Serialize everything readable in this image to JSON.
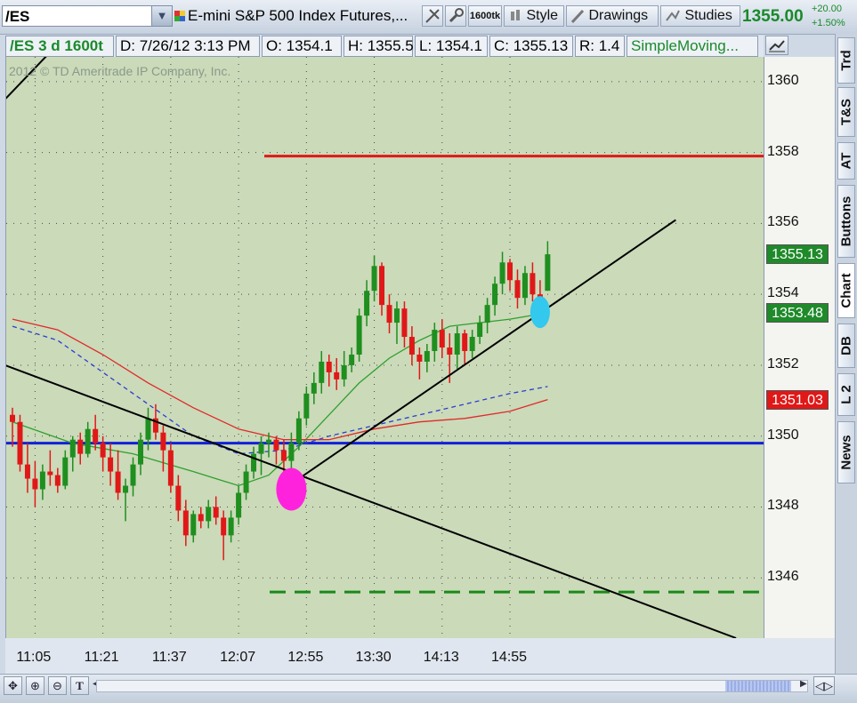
{
  "toolbar": {
    "symbol": "/ES",
    "description": "E-mini S&P 500 Index Futures,...",
    "aggregation_badge": "1600tk",
    "style_label": "Style",
    "drawings_label": "Drawings",
    "studies_label": "Studies",
    "last_price": "1355.00",
    "net_change": "+20.00",
    "pct_change": "+1.50%"
  },
  "infobar": {
    "symbol_period": "/ES 3 d 1600t",
    "date": "D: 7/26/12 3:13 PM",
    "open": "O: 1354.1",
    "high": "H: 1355.5",
    "low": "L: 1354.1",
    "close": "C: 1355.13",
    "range": "R: 1.4",
    "study": "SimpleMoving..."
  },
  "copyright": "2012 © TD Ameritrade IP Company, Inc.",
  "side_tabs": [
    "Trd",
    "T&S",
    "AT",
    "Buttons",
    "Chart",
    "DB",
    "L 2",
    "News"
  ],
  "price_badges": [
    {
      "label": "1355.13",
      "value": 1355.13,
      "color": "#1f8a2a"
    },
    {
      "label": "1353.48",
      "value": 1353.48,
      "color": "#1f8a2a"
    },
    {
      "label": "1351.03",
      "value": 1351.03,
      "color": "#e01818"
    }
  ],
  "chart_data": {
    "type": "candlestick",
    "title": "",
    "xlabel": "",
    "ylabel": "",
    "ylim": [
      1344.3,
      1360.7
    ],
    "y_ticks": [
      1346,
      1348,
      1350,
      1352,
      1354,
      1356,
      1358,
      1360
    ],
    "x_ticks": [
      {
        "label": "11:05",
        "index": 3
      },
      {
        "label": "11:21",
        "index": 12
      },
      {
        "label": "11:37",
        "index": 21
      },
      {
        "label": "12:07",
        "index": 30
      },
      {
        "label": "12:55",
        "index": 39
      },
      {
        "label": "13:30",
        "index": 48
      },
      {
        "label": "14:13",
        "index": 57
      },
      {
        "label": "14:55",
        "index": 66
      }
    ],
    "grid": true,
    "candles": [
      {
        "o": 1350.6,
        "h": 1350.8,
        "l": 1349.7,
        "c": 1350.4
      },
      {
        "o": 1350.4,
        "h": 1350.6,
        "l": 1349.0,
        "c": 1349.2
      },
      {
        "o": 1349.2,
        "h": 1349.8,
        "l": 1348.4,
        "c": 1348.8
      },
      {
        "o": 1348.8,
        "h": 1349.3,
        "l": 1348.0,
        "c": 1348.5
      },
      {
        "o": 1348.5,
        "h": 1349.2,
        "l": 1348.2,
        "c": 1349.0
      },
      {
        "o": 1349.0,
        "h": 1349.6,
        "l": 1348.6,
        "c": 1348.9
      },
      {
        "o": 1348.9,
        "h": 1349.1,
        "l": 1348.4,
        "c": 1348.6
      },
      {
        "o": 1348.6,
        "h": 1349.6,
        "l": 1348.5,
        "c": 1349.4
      },
      {
        "o": 1349.4,
        "h": 1350.0,
        "l": 1349.0,
        "c": 1349.9
      },
      {
        "o": 1349.9,
        "h": 1350.1,
        "l": 1349.2,
        "c": 1349.5
      },
      {
        "o": 1349.5,
        "h": 1350.4,
        "l": 1349.4,
        "c": 1350.2
      },
      {
        "o": 1350.2,
        "h": 1350.6,
        "l": 1349.6,
        "c": 1349.8
      },
      {
        "o": 1349.8,
        "h": 1350.0,
        "l": 1349.0,
        "c": 1349.4
      },
      {
        "o": 1349.4,
        "h": 1349.8,
        "l": 1348.6,
        "c": 1349.0
      },
      {
        "o": 1349.0,
        "h": 1349.6,
        "l": 1348.2,
        "c": 1348.4
      },
      {
        "o": 1348.4,
        "h": 1348.8,
        "l": 1347.6,
        "c": 1348.6
      },
      {
        "o": 1348.6,
        "h": 1349.4,
        "l": 1348.3,
        "c": 1349.2
      },
      {
        "o": 1349.2,
        "h": 1350.1,
        "l": 1348.9,
        "c": 1349.9
      },
      {
        "o": 1349.9,
        "h": 1350.8,
        "l": 1349.6,
        "c": 1350.5
      },
      {
        "o": 1350.5,
        "h": 1350.9,
        "l": 1349.9,
        "c": 1350.1
      },
      {
        "o": 1350.1,
        "h": 1350.3,
        "l": 1349.0,
        "c": 1349.6
      },
      {
        "o": 1349.6,
        "h": 1349.8,
        "l": 1348.4,
        "c": 1348.6
      },
      {
        "o": 1348.6,
        "h": 1348.9,
        "l": 1347.6,
        "c": 1347.9
      },
      {
        "o": 1347.9,
        "h": 1348.2,
        "l": 1346.9,
        "c": 1347.2
      },
      {
        "o": 1347.2,
        "h": 1347.9,
        "l": 1347.0,
        "c": 1347.8
      },
      {
        "o": 1347.8,
        "h": 1348.0,
        "l": 1347.4,
        "c": 1347.6
      },
      {
        "o": 1347.6,
        "h": 1348.2,
        "l": 1347.4,
        "c": 1348.0
      },
      {
        "o": 1348.0,
        "h": 1348.3,
        "l": 1347.5,
        "c": 1347.7
      },
      {
        "o": 1347.7,
        "h": 1347.9,
        "l": 1346.5,
        "c": 1347.2
      },
      {
        "o": 1347.2,
        "h": 1347.9,
        "l": 1347.0,
        "c": 1347.7
      },
      {
        "o": 1347.7,
        "h": 1348.6,
        "l": 1347.5,
        "c": 1348.4
      },
      {
        "o": 1348.4,
        "h": 1349.2,
        "l": 1348.2,
        "c": 1349.0
      },
      {
        "o": 1349.0,
        "h": 1349.7,
        "l": 1348.8,
        "c": 1349.5
      },
      {
        "o": 1349.5,
        "h": 1350.0,
        "l": 1348.9,
        "c": 1349.8
      },
      {
        "o": 1349.8,
        "h": 1350.1,
        "l": 1349.4,
        "c": 1349.9
      },
      {
        "o": 1349.9,
        "h": 1350.0,
        "l": 1349.2,
        "c": 1349.6
      },
      {
        "o": 1349.6,
        "h": 1349.9,
        "l": 1348.6,
        "c": 1349.3
      },
      {
        "o": 1349.3,
        "h": 1350.1,
        "l": 1349.0,
        "c": 1349.8
      },
      {
        "o": 1349.8,
        "h": 1350.7,
        "l": 1349.6,
        "c": 1350.5
      },
      {
        "o": 1350.5,
        "h": 1351.4,
        "l": 1350.3,
        "c": 1351.2
      },
      {
        "o": 1351.2,
        "h": 1351.8,
        "l": 1350.9,
        "c": 1351.5
      },
      {
        "o": 1351.5,
        "h": 1352.4,
        "l": 1351.2,
        "c": 1352.1
      },
      {
        "o": 1352.1,
        "h": 1352.3,
        "l": 1351.4,
        "c": 1351.8
      },
      {
        "o": 1351.8,
        "h": 1352.2,
        "l": 1351.3,
        "c": 1351.6
      },
      {
        "o": 1351.6,
        "h": 1352.4,
        "l": 1351.4,
        "c": 1352.0
      },
      {
        "o": 1352.0,
        "h": 1352.5,
        "l": 1351.8,
        "c": 1352.3
      },
      {
        "o": 1352.3,
        "h": 1353.6,
        "l": 1352.1,
        "c": 1353.4
      },
      {
        "o": 1353.4,
        "h": 1354.4,
        "l": 1353.1,
        "c": 1354.1
      },
      {
        "o": 1354.1,
        "h": 1355.1,
        "l": 1353.8,
        "c": 1354.8
      },
      {
        "o": 1354.8,
        "h": 1354.9,
        "l": 1353.4,
        "c": 1353.7
      },
      {
        "o": 1353.7,
        "h": 1354.0,
        "l": 1352.9,
        "c": 1353.2
      },
      {
        "o": 1353.2,
        "h": 1353.8,
        "l": 1352.6,
        "c": 1353.6
      },
      {
        "o": 1353.6,
        "h": 1353.8,
        "l": 1352.5,
        "c": 1352.8
      },
      {
        "o": 1352.8,
        "h": 1353.1,
        "l": 1352.0,
        "c": 1352.3
      },
      {
        "o": 1352.3,
        "h": 1352.5,
        "l": 1351.6,
        "c": 1352.1
      },
      {
        "o": 1352.1,
        "h": 1352.6,
        "l": 1351.8,
        "c": 1352.4
      },
      {
        "o": 1352.4,
        "h": 1353.2,
        "l": 1352.1,
        "c": 1353.0
      },
      {
        "o": 1353.0,
        "h": 1353.3,
        "l": 1352.2,
        "c": 1352.5
      },
      {
        "o": 1352.5,
        "h": 1352.9,
        "l": 1351.5,
        "c": 1352.3
      },
      {
        "o": 1352.3,
        "h": 1353.1,
        "l": 1351.9,
        "c": 1352.9
      },
      {
        "o": 1352.9,
        "h": 1353.0,
        "l": 1352.0,
        "c": 1352.4
      },
      {
        "o": 1352.4,
        "h": 1353.0,
        "l": 1352.2,
        "c": 1352.8
      },
      {
        "o": 1352.8,
        "h": 1353.4,
        "l": 1352.6,
        "c": 1353.2
      },
      {
        "o": 1353.2,
        "h": 1353.9,
        "l": 1352.9,
        "c": 1353.7
      },
      {
        "o": 1353.7,
        "h": 1354.5,
        "l": 1353.4,
        "c": 1354.3
      },
      {
        "o": 1354.3,
        "h": 1355.2,
        "l": 1354.0,
        "c": 1354.9
      },
      {
        "o": 1354.9,
        "h": 1355.0,
        "l": 1354.1,
        "c": 1354.4
      },
      {
        "o": 1354.4,
        "h": 1354.7,
        "l": 1353.6,
        "c": 1353.9
      },
      {
        "o": 1353.9,
        "h": 1354.8,
        "l": 1353.7,
        "c": 1354.6
      },
      {
        "o": 1354.6,
        "h": 1354.9,
        "l": 1353.8,
        "c": 1354.0
      },
      {
        "o": 1354.0,
        "h": 1354.4,
        "l": 1353.2,
        "c": 1353.6
      },
      {
        "o": 1354.1,
        "h": 1355.5,
        "l": 1354.1,
        "c": 1355.13
      }
    ],
    "colors": {
      "up": "#1f8f1f",
      "down": "#e01818",
      "background": "#cbdab9"
    },
    "studies": [
      {
        "kind": "sma-fast",
        "color": "#2ea02e",
        "dashed": false,
        "points": [
          [
            0,
            1350.4
          ],
          [
            8,
            1349.8
          ],
          [
            16,
            1349.5
          ],
          [
            24,
            1349.0
          ],
          [
            30,
            1348.6
          ],
          [
            34,
            1348.9
          ],
          [
            38,
            1349.7
          ],
          [
            42,
            1350.6
          ],
          [
            46,
            1351.5
          ],
          [
            50,
            1352.2
          ],
          [
            54,
            1352.7
          ],
          [
            58,
            1353.1
          ],
          [
            62,
            1353.2
          ],
          [
            66,
            1353.3
          ],
          [
            71,
            1353.48
          ]
        ]
      },
      {
        "kind": "sma-slow",
        "color": "#e02a2a",
        "dashed": false,
        "points": [
          [
            0,
            1353.3
          ],
          [
            6,
            1353.0
          ],
          [
            12,
            1352.3
          ],
          [
            18,
            1351.5
          ],
          [
            24,
            1350.8
          ],
          [
            30,
            1350.2
          ],
          [
            36,
            1349.9
          ],
          [
            42,
            1349.9
          ],
          [
            48,
            1350.2
          ],
          [
            54,
            1350.4
          ],
          [
            60,
            1350.5
          ],
          [
            66,
            1350.7
          ],
          [
            71,
            1351.03
          ]
        ]
      },
      {
        "kind": "sma-mid",
        "color": "#2a3fd0",
        "dashed": true,
        "points": [
          [
            0,
            1353.1
          ],
          [
            6,
            1352.7
          ],
          [
            12,
            1351.8
          ],
          [
            18,
            1350.9
          ],
          [
            24,
            1350.0
          ],
          [
            30,
            1349.5
          ],
          [
            36,
            1349.6
          ],
          [
            42,
            1350.0
          ],
          [
            48,
            1350.3
          ],
          [
            54,
            1350.6
          ],
          [
            60,
            1350.9
          ],
          [
            66,
            1351.2
          ],
          [
            71,
            1351.4
          ]
        ]
      }
    ],
    "drawings": {
      "resistance_line": {
        "y": 1357.9,
        "color": "#e01818"
      },
      "support_line": {
        "y": 1349.8,
        "color": "#1020d8"
      },
      "dashed_target_line": {
        "y": 1345.6,
        "color": "#1a8a1a"
      },
      "trendline_down": {
        "color": "#000000",
        "from": [
          -1,
          1352.0
        ],
        "to": [
          96,
          1344.3
        ]
      },
      "trendline_up": {
        "color": "#000000",
        "from": [
          38,
          1348.8
        ],
        "to": [
          88,
          1356.1
        ]
      },
      "trendline_corner": {
        "color": "#000000",
        "from": [
          -1,
          1359.5
        ],
        "to": [
          8,
          1361.5
        ]
      },
      "marker_magenta": {
        "index": 37,
        "y": 1348.5,
        "color": "#ff22dd"
      },
      "marker_cyan": {
        "index": 70,
        "y": 1353.5,
        "color": "#33c8ee"
      }
    }
  }
}
